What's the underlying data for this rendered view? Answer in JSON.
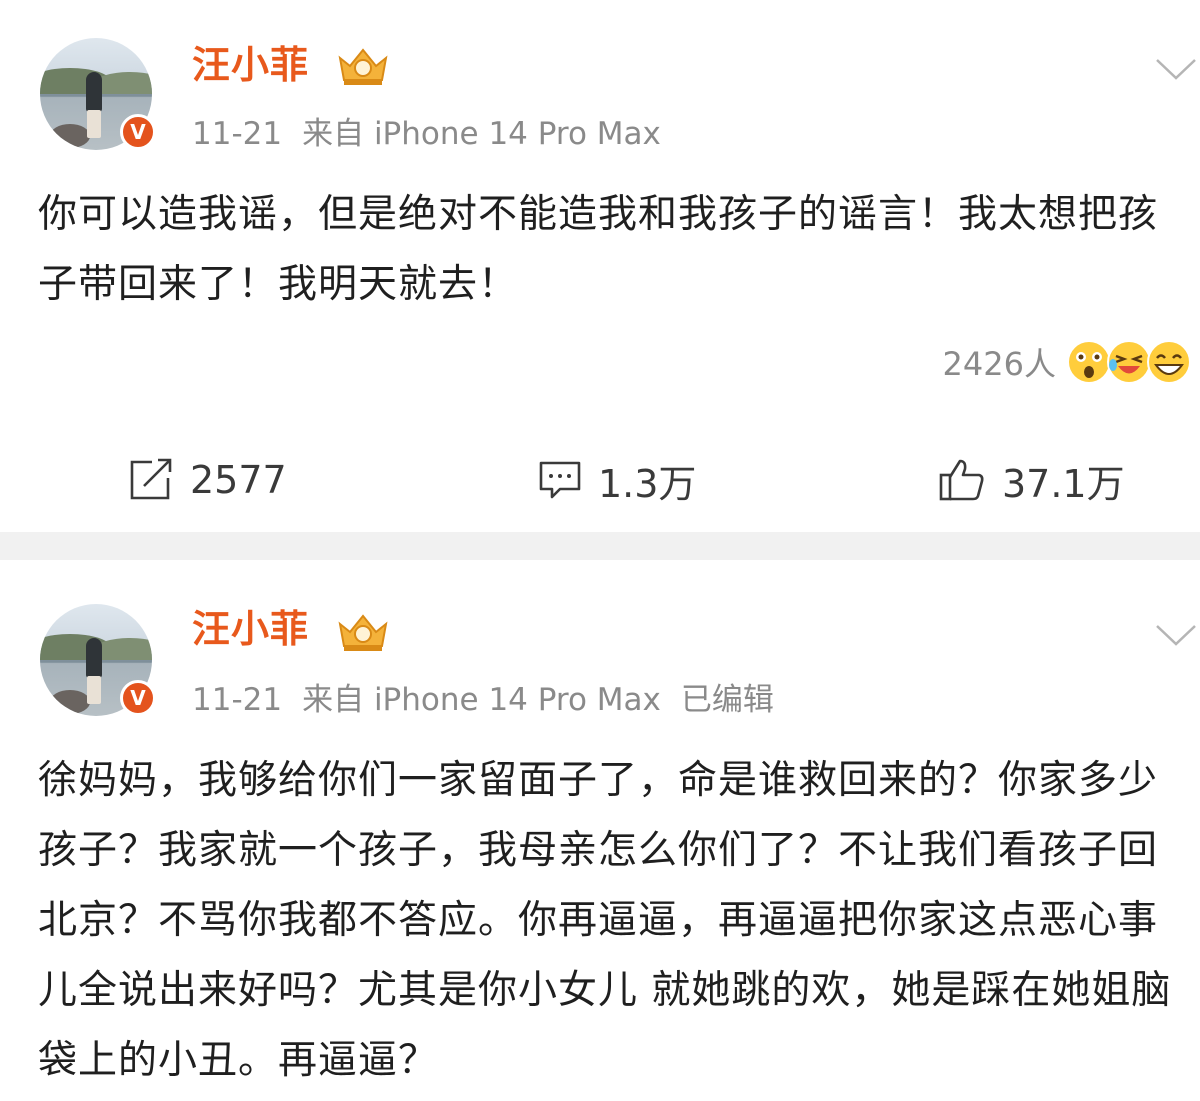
{
  "colors": {
    "username": "#e8591c",
    "meta": "#8a8a8a",
    "badge": "#e4531d",
    "divider": "#f1f1f1"
  },
  "post1": {
    "username": "汪小菲",
    "date": "11-21",
    "source": "来自 iPhone 14 Pro Max",
    "content": "你可以造我谣，但是绝对不能造我和我孩子的谣言！我太想把孩子带回来了！我明天就去！",
    "reactions_count": "2426人",
    "reaction_icons": [
      "surprised-emoji-icon",
      "laugh-cry-emoji-icon",
      "grin-emoji-icon"
    ],
    "shares": "2577",
    "comments": "1.3万",
    "likes": "37.1万"
  },
  "post2": {
    "username": "汪小菲",
    "date": "11-21",
    "source": "来自 iPhone 14 Pro Max",
    "edited": "已编辑",
    "content": "徐妈妈，我够给你们一家留面子了，命是谁救回来的？你家多少孩子？我家就一个孩子，我母亲怎么你们了？不让我们看孩子回北京？不骂你我都不答应。你再逼逼，再逼逼把你家这点恶心事儿全说出来好吗？尤其是你小女儿 就她跳的欢，她是踩在她姐脑袋上的小丑。再逼逼？"
  }
}
